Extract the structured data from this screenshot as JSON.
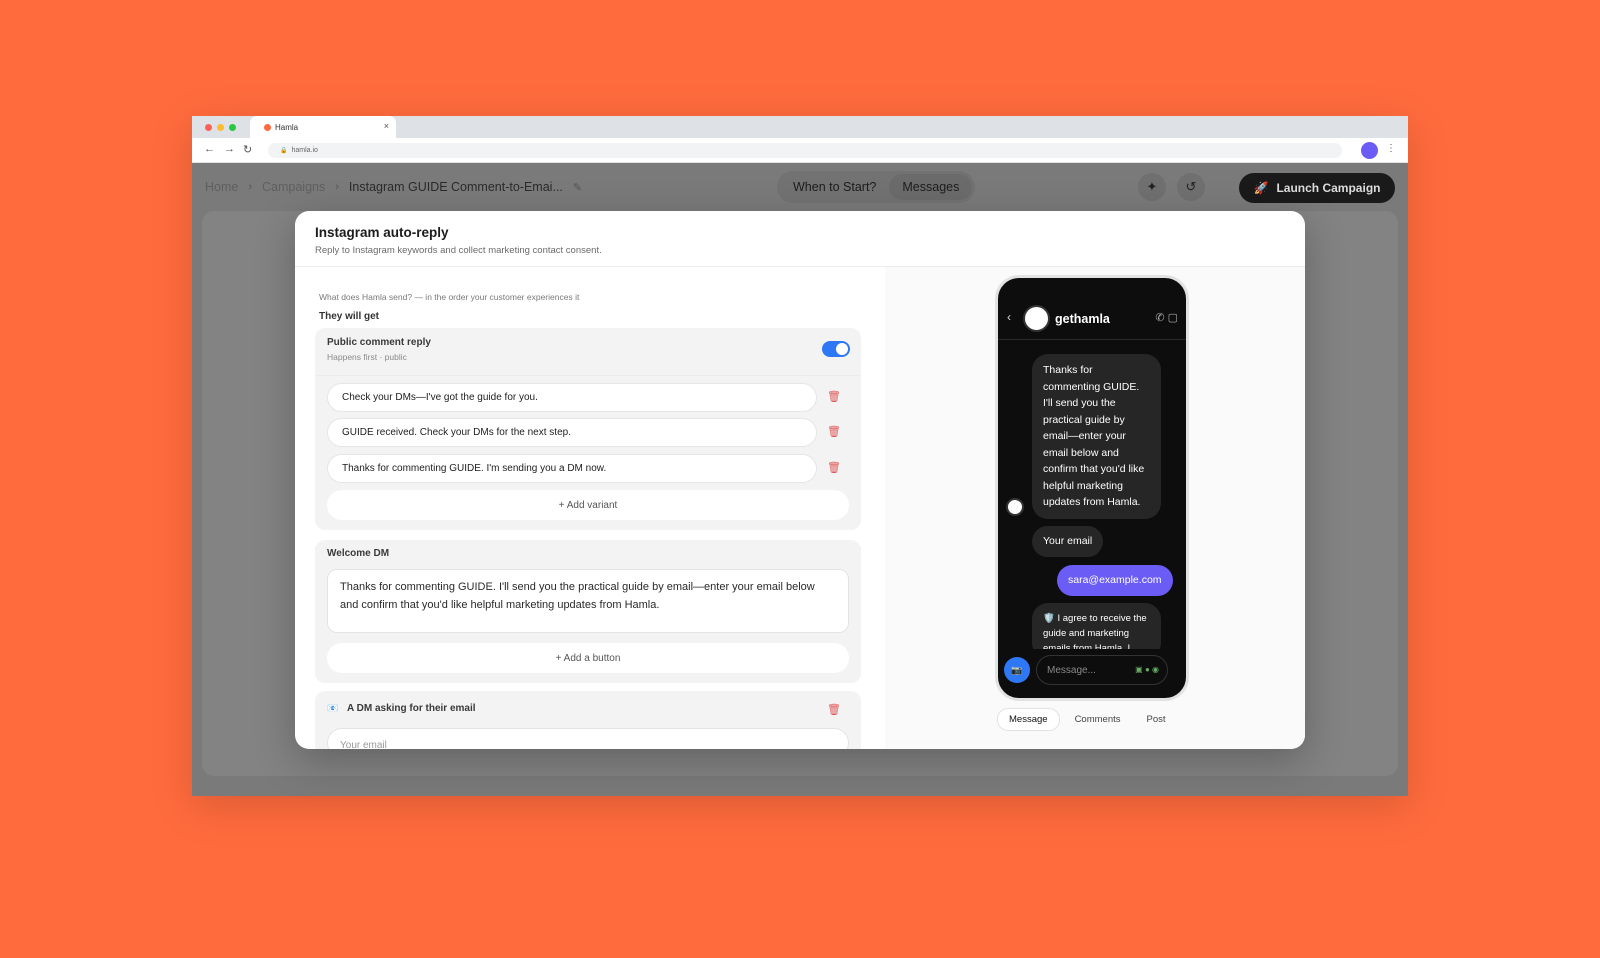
{
  "browser": {
    "tab_title": "Hamla",
    "tab_close": "×",
    "url": "hamla.io"
  },
  "header": {
    "breadcrumbs": [
      "Home",
      "Campaigns",
      "Instagram GUIDE Comment-to-Emai..."
    ],
    "tabs": [
      "When to Start?",
      "Messages"
    ],
    "launch_label": "Launch Campaign"
  },
  "modal": {
    "title": "Instagram auto-reply",
    "subtitle": "Reply to Instagram keywords and collect marketing contact consent.",
    "intro": "What does Hamla send? — in the order your customer experiences it",
    "get_label": "They will get",
    "public_reply": {
      "title": "Public comment reply",
      "meta": "Happens first · public",
      "enabled": true,
      "variants": [
        "Check your DMs—I've got the guide for you.",
        "GUIDE received. Check your DMs for the next step.",
        "Thanks for commenting GUIDE. I'm sending you a DM now."
      ],
      "add_variant": "+ Add variant"
    },
    "welcome_dm": {
      "title": "Welcome DM",
      "text": "Thanks for commenting GUIDE. I'll send you the practical guide by email—enter your email below and confirm that you'd like helpful marketing updates from Hamla.",
      "add_button": "+ Add a button"
    },
    "email_dm": {
      "title": "A DM asking for their email",
      "placeholder": "Your email"
    }
  },
  "preview": {
    "handle": "gethamla",
    "messages": [
      "Thanks for commenting GUIDE. I'll send you the practical guide by email—enter your email below and confirm that you'd like helpful marketing updates from Hamla.",
      "Your email",
      "sara@example.com",
      "🛡️ I agree to receive the guide and marketing emails from Hamla. I"
    ],
    "composer_placeholder": "Message...",
    "tabs": [
      "Message",
      "Comments",
      "Post"
    ],
    "active_tab": "Message"
  },
  "colors": {
    "background": "#FF6B3D",
    "accent_blue": "#2f78f5",
    "accent_purple": "#6b5cf6",
    "delete_red": "#e05656"
  }
}
